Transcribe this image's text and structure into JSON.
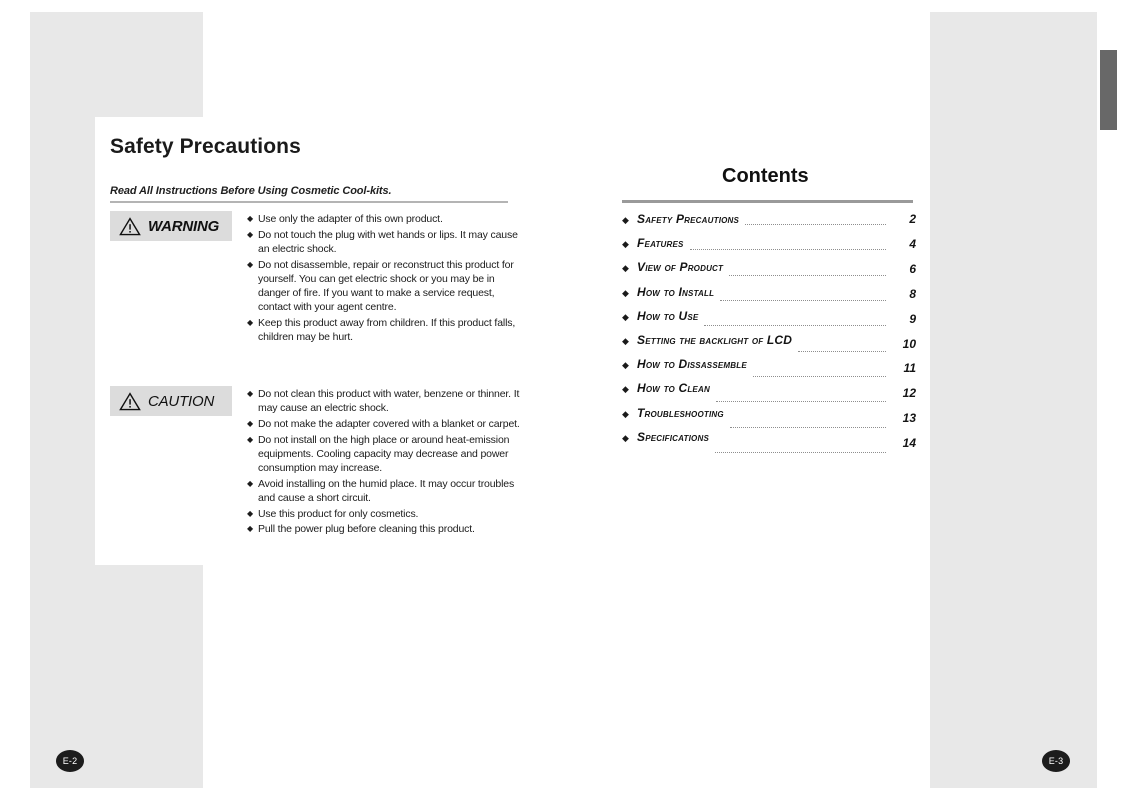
{
  "left_page": {
    "title": "Safety Precautions",
    "subtitle": "Read All Instructions Before Using Cosmetic Cool-kits.",
    "page_badge": "E-2",
    "notices": [
      {
        "label": "WARNING",
        "icon": "warning-triangle-icon",
        "emphasis": "heavy",
        "items": [
          "Use only the adapter of this own product.",
          "Do not touch the plug with wet hands or lips. It may cause an electric shock.",
          "Do not disassemble, repair or reconstruct this product for yourself. You can get electric shock or you may be in danger of fire. If you want to make a service request, contact with your agent centre.",
          "Keep this product away from children. If this product falls, children may be hurt."
        ]
      },
      {
        "label": "CAUTION",
        "icon": "warning-triangle-icon",
        "emphasis": "normal",
        "items": [
          "Do not clean this product with water, benzene or thinner. It may cause an electric shock.",
          "Do not make the adapter covered with a blanket or carpet.",
          "Do not install on the high place or around heat-emission equipments. Cooling capacity may decrease and power consumption may increase.",
          "Avoid installing on the humid place. It may occur troubles and cause a short circuit.",
          "Use this product for only cosmetics.",
          "Pull the power plug before cleaning this product."
        ]
      }
    ]
  },
  "right_page": {
    "title": "Contents",
    "page_badge": "E-3",
    "entries": [
      {
        "label": "Safety Precautions",
        "page": "2"
      },
      {
        "label": "Features",
        "page": "4"
      },
      {
        "label": "View of Product",
        "page": "6"
      },
      {
        "label": "How to Install",
        "page": "8"
      },
      {
        "label": "How to Use",
        "page": "9"
      },
      {
        "label": "Setting the backlight of  LCD",
        "page": "10"
      },
      {
        "label": "How to Dissassemble",
        "page": "11"
      },
      {
        "label": "How to Clean",
        "page": "12"
      },
      {
        "label": "Troubleshooting",
        "page": "13"
      },
      {
        "label": "Specifications",
        "page": "14"
      }
    ]
  },
  "colors": {
    "paper": "#ffffff",
    "panel_gray": "#e8e8e8",
    "label_gray": "#dcdcdc",
    "rule_gray": "#9a9a9a",
    "ink": "#1c1c1c",
    "tab_marker": "#686868"
  }
}
